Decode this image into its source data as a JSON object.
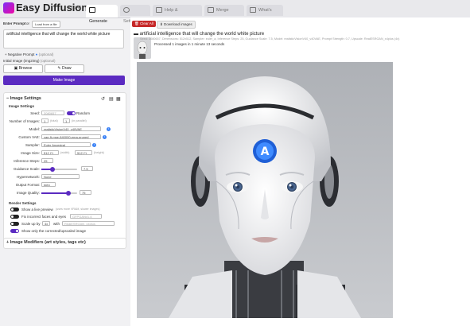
{
  "app": {
    "title": "Easy Diffusion",
    "version": "v2.5.41"
  },
  "tabs": [
    {
      "label": "Generate",
      "active": true
    },
    {
      "label": "Settings"
    },
    {
      "label": "Help & Community"
    },
    {
      "label": "Merge models"
    },
    {
      "label": "What's new"
    }
  ],
  "prompt": {
    "label": "Enter Prompt",
    "or": "or",
    "load_file": "Load from a file",
    "value": "artificial intelligence that will change the world white picture",
    "negative_label": "Negative Prompt",
    "negative_hint": "(optional)",
    "init_label": "Initial Image (img2img)",
    "init_hint": "(optional)",
    "browse": "Browse",
    "draw": "Draw",
    "make_image": "Make Image"
  },
  "settings": {
    "header": "Image Settings",
    "section": "Image Settings",
    "seed_label": "Seed:",
    "seed_value": "3080657",
    "random_label": "Random",
    "num_images_label": "Number of Images:",
    "num_images_total": "1",
    "num_images_total_hint": "(total)",
    "num_images_parallel": "1",
    "num_images_parallel_hint": "(in parallel)",
    "model_label": "Model:",
    "model_value": "realisticVisionV40_v40VAE",
    "vae_label": "Custom VAE:",
    "vae_value": "vae-ft-mse-840000-ema-pruned",
    "sampler_label": "Sampler:",
    "sampler_value": "Euler Ancestral",
    "size_label": "Image Size:",
    "width_value": "512 (*)",
    "width_hint": "(width)",
    "height_value": "512 (*)",
    "height_hint": "(height)",
    "steps_label": "Inference Steps:",
    "steps_value": "25",
    "guidance_label": "Guidance Scale:",
    "guidance_value": "7.5",
    "guidance_fraction": 0.3,
    "hyper_label": "Hypernetwork:",
    "hyper_value": "None",
    "format_label": "Output Format:",
    "format_value": "jpeg",
    "quality_label": "Image Quality:",
    "quality_value": "75",
    "quality_fraction": 0.75,
    "render_header": "Render Settings",
    "live_preview": "Show a live preview",
    "live_preview_hint": "(uses more VRAM, slower images)",
    "fix_faces": "Fix incorrect faces and eyes",
    "fix_faces_model": "GFPGANv1.4",
    "scale_up": "Scale up by",
    "scale_value": "4x",
    "scale_with": "with",
    "scale_model": "RealESRGAN_x4plus",
    "show_corrected": "Show only the corrected/upscaled image",
    "modifiers": "Image Modifiers (art styles, tags etc)"
  },
  "output": {
    "clear_all": "Clear All",
    "download": "Download images",
    "task_prompt": "artificial intelligence that will change the world white picture",
    "meta": "Seed: 3080657, Dimensions: 512x512, Sampler: euler_a, Inference Steps: 25, Guidance Scale: 7.5, Model: realisticVisionV40_v40VAE, Prompt Strength: 0.7, Upscale: RealESRGAN_x4plus (4x)",
    "processed": "Processed 1 images in 1 minute 13 seconds"
  },
  "colors": {
    "accent": "#5b2bc1",
    "danger": "#c62828",
    "info": "#3b82f6"
  },
  "icons": [
    "logo",
    "generate-icon",
    "settings-icon",
    "help-icon",
    "merge-icon",
    "news-icon",
    "browse-icon",
    "draw-icon",
    "undo-icon",
    "copy-icon",
    "paste-icon",
    "trash-icon",
    "download-icon"
  ]
}
